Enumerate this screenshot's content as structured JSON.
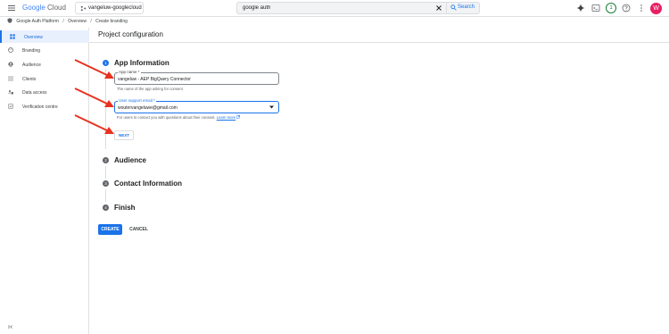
{
  "topbar": {
    "logo_google": "Google",
    "logo_cloud": "Cloud",
    "project": "vangeluw-googlecloud",
    "search_value": "google auth",
    "search_button": "Search",
    "notification_count": "1",
    "avatar_initial": "W"
  },
  "breadcrumb": {
    "items": [
      "Google Auth Platform",
      "Overview",
      "Create branding"
    ]
  },
  "sidebar": {
    "items": [
      {
        "label": "Overview",
        "icon": "grid-icon"
      },
      {
        "label": "Branding",
        "icon": "palette-icon"
      },
      {
        "label": "Audience",
        "icon": "person-icon"
      },
      {
        "label": "Clients",
        "icon": "apps-icon"
      },
      {
        "label": "Data access",
        "icon": "data-access-icon"
      },
      {
        "label": "Verification centre",
        "icon": "verification-icon"
      }
    ],
    "active_index": 0
  },
  "main": {
    "title": "Project configuration",
    "steps": [
      {
        "num": "1",
        "title": "App Information"
      },
      {
        "num": "2",
        "title": "Audience"
      },
      {
        "num": "3",
        "title": "Contact Information"
      },
      {
        "num": "4",
        "title": "Finish"
      }
    ],
    "app_name": {
      "label": "App name *",
      "value": "vangeluw - AEP BigQuery Connector",
      "hint": "The name of the app asking for consent"
    },
    "support_email": {
      "label": "User support email *",
      "value": "woutervangeluwe@gmail.com",
      "hint": "For users to contact you with questions about their consent.",
      "learn_more": "Learn more"
    },
    "next_button": "NEXT",
    "create_button": "CREATE",
    "cancel_button": "CANCEL"
  },
  "colors": {
    "accent": "#1a73e8",
    "annotation_arrow": "#e8321f",
    "avatar": "#e91e63"
  }
}
